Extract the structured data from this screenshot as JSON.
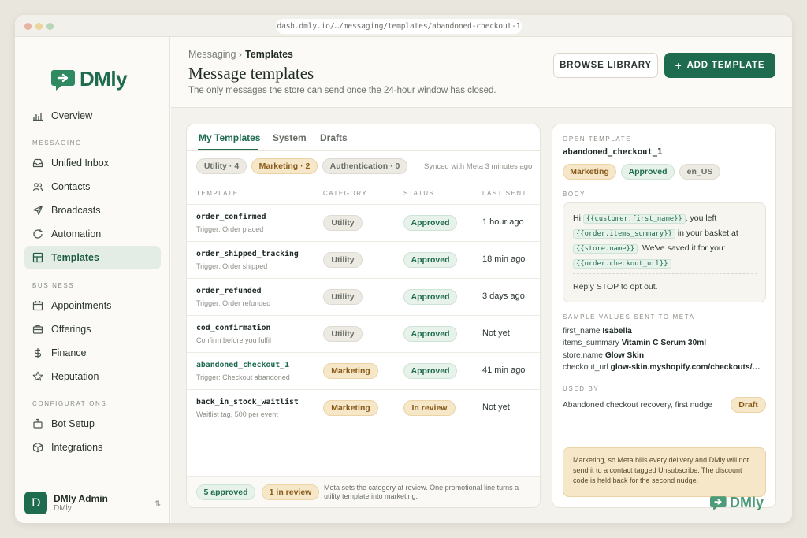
{
  "browser": {
    "url": "dash.dmly.io/…/messaging/templates/abandoned-checkout-1"
  },
  "brand": {
    "name": "DMly",
    "accent": "#1e6b4f"
  },
  "sidebar": {
    "overview": "Overview",
    "sections": {
      "messaging": "MESSAGING",
      "business": "BUSINESS",
      "configurations": "CONFIGURATIONS"
    },
    "messaging": [
      "Unified Inbox",
      "Contacts",
      "Broadcasts",
      "Automation",
      "Templates"
    ],
    "business": [
      "Appointments",
      "Offerings",
      "Finance",
      "Reputation"
    ],
    "configurations": [
      "Bot Setup",
      "Integrations"
    ],
    "user": {
      "initial": "D",
      "name": "DMly Admin",
      "org": "DMly"
    }
  },
  "header": {
    "crumb_parent": "Messaging",
    "crumb_current": "Templates",
    "title": "Message templates",
    "subtitle": "The only messages the store can send once the 24-hour window has closed.",
    "browse_label": "BROWSE LIBRARY",
    "add_label": "ADD TEMPLATE"
  },
  "templates": {
    "tabs": [
      "My Templates",
      "System",
      "Drafts"
    ],
    "filters": [
      "Utility · 4",
      "Marketing · 2",
      "Authentication · 0"
    ],
    "synced": "Synced with Meta 3 minutes ago",
    "columns": [
      "TEMPLATE",
      "CATEGORY",
      "STATUS",
      "LAST SENT"
    ],
    "rows": [
      {
        "name": "order_confirmed",
        "trigger": "Trigger: Order placed",
        "category": "Utility",
        "status": "Approved",
        "last": "1 hour ago"
      },
      {
        "name": "order_shipped_tracking",
        "trigger": "Trigger: Order shipped",
        "category": "Utility",
        "status": "Approved",
        "last": "18 min ago"
      },
      {
        "name": "order_refunded",
        "trigger": "Trigger: Order refunded",
        "category": "Utility",
        "status": "Approved",
        "last": "3 days ago"
      },
      {
        "name": "cod_confirmation",
        "trigger": "Confirm before you fulfil",
        "category": "Utility",
        "status": "Approved",
        "last": "Not yet"
      },
      {
        "name": "abandoned_checkout_1",
        "trigger": "Trigger: Checkout abandoned",
        "category": "Marketing",
        "status": "Approved",
        "last": "41 min ago"
      },
      {
        "name": "back_in_stock_waitlist",
        "trigger": "Waitlist tag, 500 per event",
        "category": "Marketing",
        "status": "In review",
        "last": "Not yet"
      }
    ],
    "footer": {
      "approved": "5 approved",
      "review": "1 in review",
      "note": "Meta sets the category at review. One promotional line turns a utility template into marketing."
    }
  },
  "detail": {
    "open_label": "OPEN TEMPLATE",
    "name": "abandoned_checkout_1",
    "tags": [
      "Marketing",
      "Approved",
      "en_US"
    ],
    "body_label": "BODY",
    "body": {
      "hi": "Hi",
      "v1": "{{customer.first_name}}",
      "t1": ", you left",
      "v2": "{{order.items_summary}}",
      "t2": "in your basket at",
      "v3": "{{store.name}}",
      "t3": ". We've saved it for you:",
      "v4": "{{order.checkout_url}}",
      "reply": "Reply STOP to opt out."
    },
    "sample_label": "SAMPLE VALUES SENT TO META",
    "samples": [
      {
        "key": "first_name",
        "value": "Isabella"
      },
      {
        "key": "items_summary",
        "value": "Vitamin C Serum 30ml"
      },
      {
        "key": "store.name",
        "value": "Glow Skin"
      },
      {
        "key": "checkout_url",
        "value": "glow-skin.myshopify.com/checkouts/…"
      }
    ],
    "used_label": "USED BY",
    "used_by": "Abandoned checkout recovery, first nudge",
    "used_status": "Draft",
    "note": "Marketing, so Meta bills every delivery and DMly will not send it to a contact tagged Unsubscribe. The discount code is held back for the second nudge."
  }
}
